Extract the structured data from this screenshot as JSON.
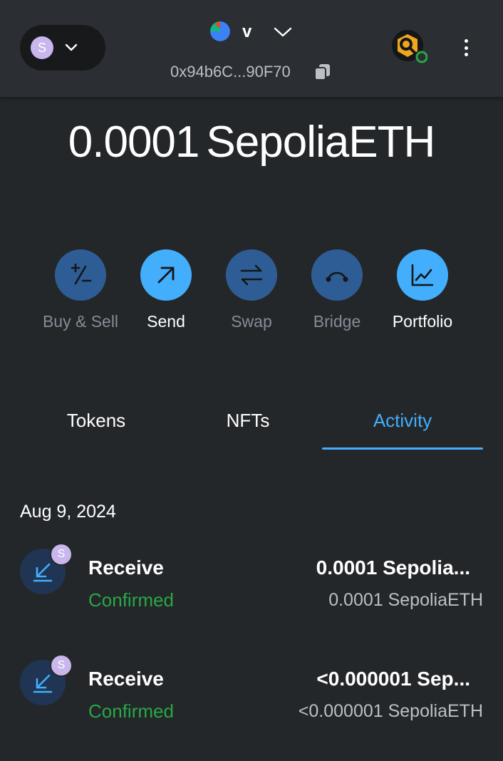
{
  "header": {
    "network_avatar_letter": "S",
    "account_name": "v",
    "account_address": "0x94b6C...90F70",
    "account_avatar_colors": [
      "#e5462d",
      "#3b82f6",
      "#10b981"
    ],
    "connection_status_color": "#28a745"
  },
  "balance": {
    "amount": "0.0001",
    "unit": "SepoliaETH"
  },
  "actions": [
    {
      "label": "Buy & Sell",
      "icon": "plus-minus-icon",
      "enabled": false
    },
    {
      "label": "Send",
      "icon": "arrow-up-right-icon",
      "enabled": true
    },
    {
      "label": "Swap",
      "icon": "swap-arrows-icon",
      "enabled": false
    },
    {
      "label": "Bridge",
      "icon": "bridge-icon",
      "enabled": false
    },
    {
      "label": "Portfolio",
      "icon": "chart-icon",
      "enabled": true
    }
  ],
  "tabs": [
    {
      "label": "Tokens",
      "active": false
    },
    {
      "label": "NFTs",
      "active": false
    },
    {
      "label": "Activity",
      "active": true
    }
  ],
  "activity": {
    "date": "Aug 9, 2024",
    "transactions": [
      {
        "title": "Receive",
        "status": "Confirmed",
        "amount": "0.0001 Sepolia...",
        "fiat": "0.0001 SepoliaETH",
        "badge": "S",
        "icon": "receive-arrow-icon"
      },
      {
        "title": "Receive",
        "status": "Confirmed",
        "amount": "<0.000001 Sep...",
        "fiat": "<0.000001 SepoliaETH",
        "badge": "S",
        "icon": "receive-arrow-icon"
      }
    ]
  },
  "colors": {
    "background": "#24272a",
    "header": "#2b2e32",
    "accent": "#43aefc",
    "action_disabled": "#2e5d95",
    "success": "#28a745"
  }
}
